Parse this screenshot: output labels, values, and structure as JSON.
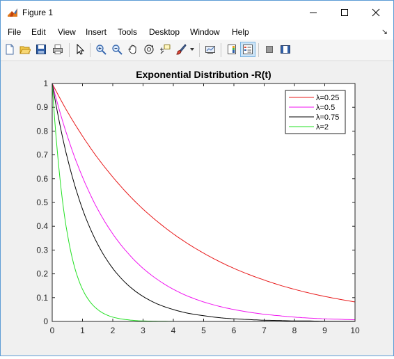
{
  "window": {
    "title": "Figure 1",
    "icon": "matlab-figure-icon",
    "controls": [
      "minimize-icon",
      "maximize-icon",
      "close-icon"
    ]
  },
  "menu": {
    "items": [
      "File",
      "Edit",
      "View",
      "Insert",
      "Tools",
      "Desktop",
      "Window",
      "Help"
    ],
    "overflow_icon": "undock-arrow-icon"
  },
  "toolbar": {
    "buttons": [
      "new-figure-icon",
      "open-file-icon",
      "save-icon",
      "print-icon",
      "edit-plot-icon",
      "zoom-in-icon",
      "zoom-out-icon",
      "pan-icon",
      "rotate-3d-icon",
      "data-cursor-icon",
      "brush-icon",
      "brush-dropdown-icon",
      "link-plot-icon",
      "insert-colorbar-icon",
      "insert-legend-icon",
      "hide-plot-tools-icon",
      "show-plot-tools-icon"
    ],
    "pressed": "insert-legend-icon"
  },
  "chart_data": {
    "type": "line",
    "title": "Exponential Distribution -R(t)",
    "xlabel": "",
    "ylabel": "",
    "xlim": [
      0,
      10
    ],
    "ylim": [
      0,
      1
    ],
    "x_ticks": [
      "0",
      "1",
      "2",
      "3",
      "4",
      "5",
      "6",
      "7",
      "8",
      "9",
      "10"
    ],
    "y_ticks": [
      "0",
      "0.1",
      "0.2",
      "0.3",
      "0.4",
      "0.5",
      "0.6",
      "0.7",
      "0.8",
      "0.9",
      "1"
    ],
    "grid": false,
    "legend_position": "top-right",
    "x": [
      0,
      0.25,
      0.5,
      0.75,
      1,
      1.5,
      2,
      2.5,
      3,
      3.5,
      4,
      4.5,
      5,
      5.5,
      6,
      6.5,
      7,
      7.5,
      8,
      8.5,
      9,
      9.5,
      10
    ],
    "series": [
      {
        "name": "λ=0.25",
        "color": "#e8191a",
        "values": [
          1,
          0.939,
          0.882,
          0.829,
          0.779,
          0.687,
          0.607,
          0.535,
          0.472,
          0.417,
          0.368,
          0.325,
          0.287,
          0.253,
          0.223,
          0.197,
          0.174,
          0.153,
          0.135,
          0.119,
          0.105,
          0.093,
          0.082
        ]
      },
      {
        "name": "λ=0.5",
        "color": "#f013f0",
        "values": [
          1,
          0.882,
          0.779,
          0.687,
          0.607,
          0.472,
          0.368,
          0.287,
          0.223,
          0.174,
          0.135,
          0.105,
          0.082,
          0.064,
          0.05,
          0.039,
          0.03,
          0.024,
          0.018,
          0.014,
          0.011,
          0.009,
          0.007
        ]
      },
      {
        "name": "λ=0.75",
        "color": "#000000",
        "values": [
          1,
          0.829,
          0.687,
          0.57,
          0.472,
          0.325,
          0.223,
          0.153,
          0.105,
          0.072,
          0.05,
          0.034,
          0.024,
          0.016,
          0.011,
          0.008,
          0.005,
          0.004,
          0.002,
          0.002,
          0.001,
          0.001,
          0.001
        ]
      },
      {
        "name": "λ=2",
        "color": "#22e022",
        "values": [
          1,
          0.607,
          0.368,
          0.223,
          0.135,
          0.05,
          0.018,
          0.007,
          0.002,
          0.001,
          0,
          0,
          0,
          0,
          0,
          0,
          0,
          0,
          0,
          0,
          0,
          0,
          0
        ]
      }
    ]
  }
}
